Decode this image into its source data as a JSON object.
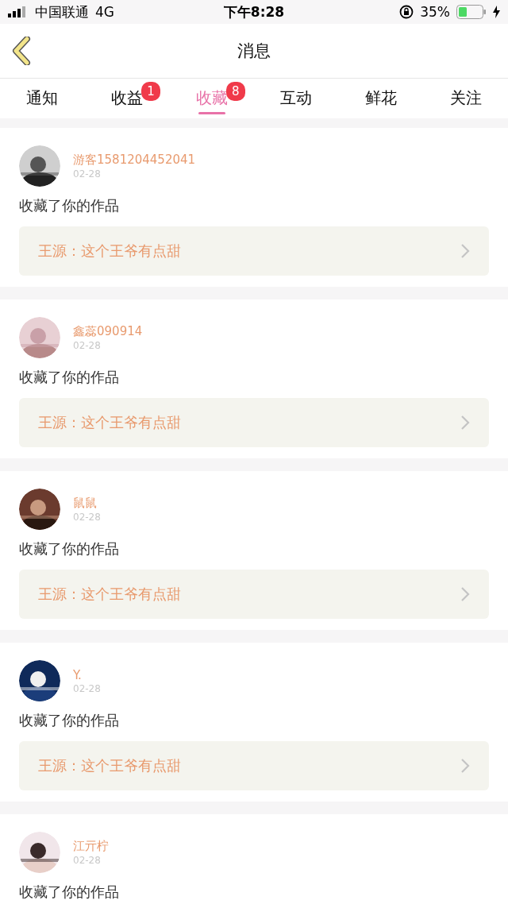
{
  "status_bar": {
    "carrier": "中国联通",
    "network": "4G",
    "time": "下午8:28",
    "battery": "35%"
  },
  "nav": {
    "title": "消息"
  },
  "tabs": [
    {
      "label": "通知",
      "selected": false
    },
    {
      "label": "收益",
      "selected": false,
      "badge": "1"
    },
    {
      "label": "收藏",
      "selected": true,
      "badge": "8"
    },
    {
      "label": "互动",
      "selected": false
    },
    {
      "label": "鲜花",
      "selected": false
    },
    {
      "label": "关注",
      "selected": false
    }
  ],
  "messages": [
    {
      "user": "游客1581204452041",
      "date": "02-28",
      "action": "收藏了你的作品",
      "quote": "王源：这个王爷有点甜"
    },
    {
      "user": "鑫蕊090914",
      "date": "02-28",
      "action": "收藏了你的作品",
      "quote": "王源：这个王爷有点甜"
    },
    {
      "user": "鼠鼠",
      "date": "02-28",
      "action": "收藏了你的作品",
      "quote": "王源：这个王爷有点甜"
    },
    {
      "user": "Y.",
      "date": "02-28",
      "action": "收藏了你的作品",
      "quote": "王源：这个王爷有点甜"
    },
    {
      "user": "江亓柠",
      "date": "02-28",
      "action": "收藏了你的作品"
    }
  ]
}
